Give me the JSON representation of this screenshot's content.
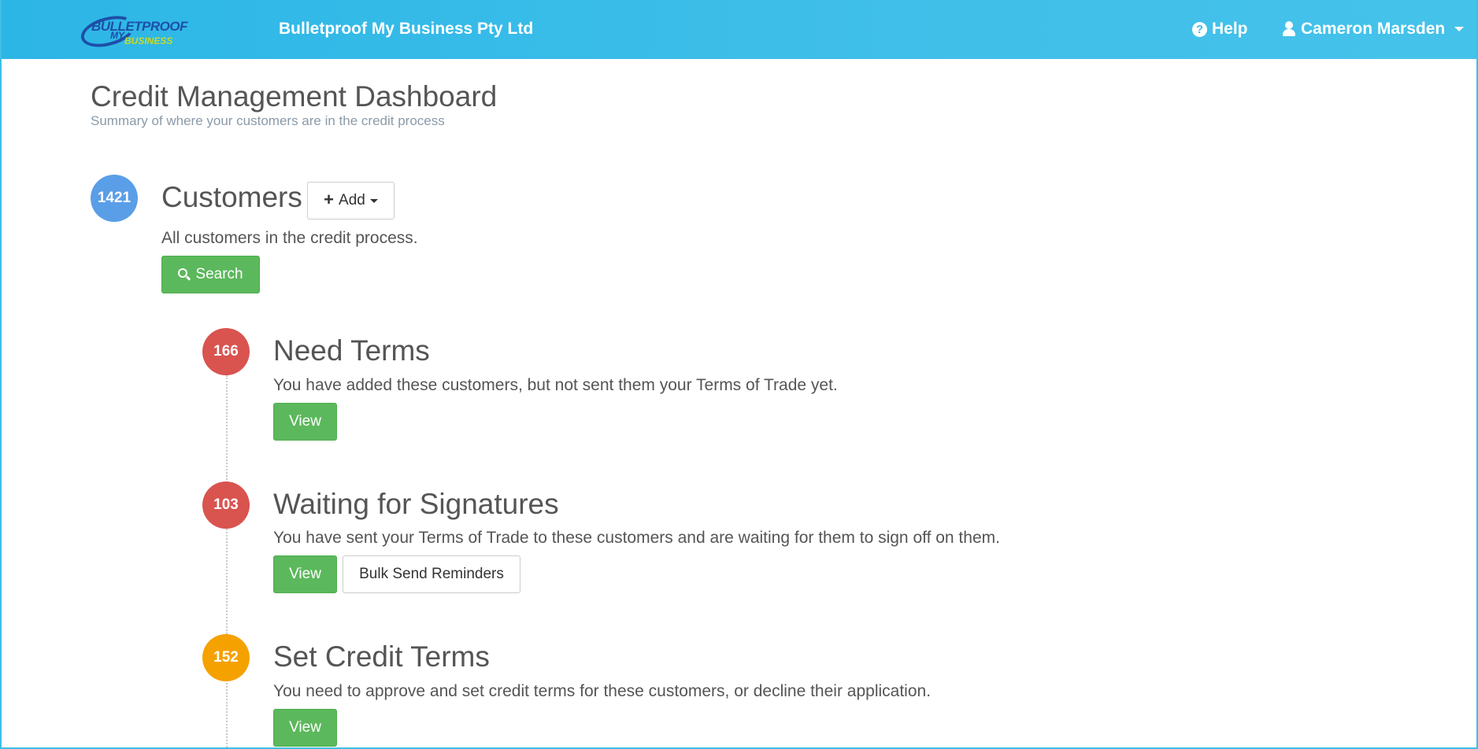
{
  "navbar": {
    "logo_text_1": "BULLETPROOF",
    "logo_text_2": "MY",
    "logo_text_3": "BUSINESS",
    "brand": "Bulletproof My Business Pty Ltd",
    "help_label": "Help",
    "user_label": "Cameron Marsden"
  },
  "header": {
    "title": "Credit Management Dashboard",
    "subtitle": "Summary of where your customers are in the credit process"
  },
  "customers": {
    "count": "1421",
    "title": "Customers",
    "add_label": "Add",
    "description": "All customers in the credit process.",
    "search_label": "Search"
  },
  "stages": [
    {
      "count": "166",
      "title": "Need Terms",
      "description": "You have added these customers, but not sent them your Terms of Trade yet.",
      "view_label": "View"
    },
    {
      "count": "103",
      "title": "Waiting for Signatures",
      "description": "You have sent your Terms of Trade to these customers and are waiting for them to sign off on them.",
      "view_label": "View",
      "reminders_label": "Bulk Send Reminders"
    },
    {
      "count": "152",
      "title": "Set Credit Terms",
      "description": "You need to approve and set credit terms for these customers, or decline their application.",
      "view_label": "View"
    }
  ],
  "colors": {
    "navbar": "#3bbde8",
    "green": "#5cb85c",
    "blue_badge": "#5a9ee8",
    "red_badge": "#d9534f",
    "orange_badge": "#f5a100"
  }
}
